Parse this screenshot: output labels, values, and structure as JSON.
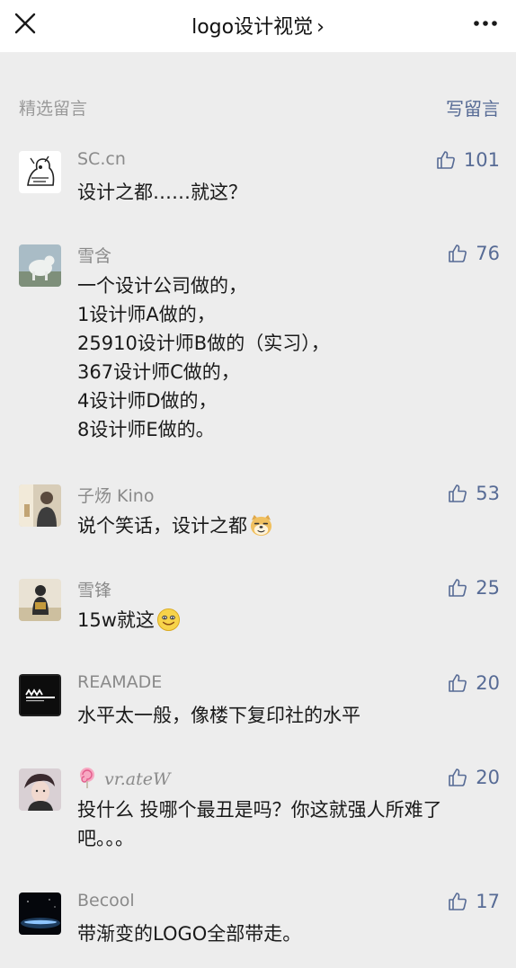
{
  "header": {
    "title": "logo设计视觉",
    "chevron": "›"
  },
  "section": {
    "title": "精选留言",
    "write_label": "写留言"
  },
  "colors": {
    "link": "#576b95",
    "nickname": "#8a8a8a",
    "background": "#ededed"
  },
  "comments": [
    {
      "nickname": "SC.cn",
      "likes": "101",
      "lines": [
        "设计之都……就这？"
      ]
    },
    {
      "nickname": "雪含",
      "likes": "76",
      "lines": [
        "一个设计公司做的，",
        "1设计师A做的，",
        "25910设计师B做的（实习），",
        "367设计师C做的，",
        "4设计师D做的，",
        "8设计师E做的。"
      ]
    },
    {
      "nickname": "子炀 Kino",
      "likes": "53",
      "lines": [
        "说个笑话，设计之都"
      ],
      "emoji": "doge-emoji"
    },
    {
      "nickname": "雪锋",
      "likes": "25",
      "lines": [
        "15w就这"
      ],
      "emoji": "smile-emoji"
    },
    {
      "nickname": "REAMADE",
      "likes": "20",
      "lines": [
        "水平太一般，像楼下复印社的水平"
      ]
    },
    {
      "nickname": "vr.ateW",
      "nickname_prefix_icon": "lollipop-icon",
      "likes": "20",
      "lines": [
        "投什么 投哪个最丑是吗？你这就强人所难了",
        "吧。。。"
      ]
    },
    {
      "nickname": "Becool",
      "likes": "17",
      "lines": [
        "带渐变的LOGO全部带走。"
      ]
    }
  ]
}
